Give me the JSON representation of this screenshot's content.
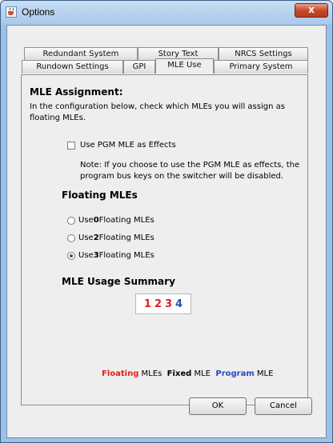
{
  "window": {
    "title": "Options",
    "close_glyph": "x"
  },
  "tabs_back": [
    {
      "label": "Redundant System"
    },
    {
      "label": "Story Text"
    },
    {
      "label": "NRCS Settings"
    }
  ],
  "tabs_front": [
    {
      "label": "Rundown Settings"
    },
    {
      "label": "GPI"
    },
    {
      "label": "MLE Use",
      "active": true
    },
    {
      "label": "Primary System"
    }
  ],
  "mle": {
    "heading": "MLE Assignment:",
    "intro": "In the configuration below, check which MLEs you will assign as floating MLEs.",
    "checkbox_label": "Use PGM MLE as Effects",
    "checkbox_checked": false,
    "note": "Note: If you choose to use the PGM MLE as effects, the program bus keys on the switcher will be disabled."
  },
  "floating": {
    "heading": "Floating MLEs",
    "options": [
      {
        "pre": "Use ",
        "num": "0",
        "post": " Floating MLEs",
        "checked": false
      },
      {
        "pre": "Use ",
        "num": "2",
        "post": " Floating MLEs",
        "checked": false
      },
      {
        "pre": "Use ",
        "num": "3",
        "post": " Floating MLEs",
        "checked": true
      }
    ]
  },
  "summary": {
    "heading": "MLE Usage Summary",
    "numbers": [
      {
        "n": "1",
        "kind": "floating"
      },
      {
        "n": "2",
        "kind": "floating"
      },
      {
        "n": "3",
        "kind": "floating"
      },
      {
        "n": "4",
        "kind": "program"
      }
    ]
  },
  "legend": {
    "floating_word": "Floating",
    "floating_rest": " MLEs",
    "fixed_word": "Fixed",
    "fixed_rest": " MLE",
    "program_word": "Program",
    "program_rest": " MLE"
  },
  "colors": {
    "floating": "#e0201b",
    "fixed": "#000000",
    "program": "#2a49b8"
  },
  "buttons": {
    "ok": "OK",
    "cancel": "Cancel"
  }
}
